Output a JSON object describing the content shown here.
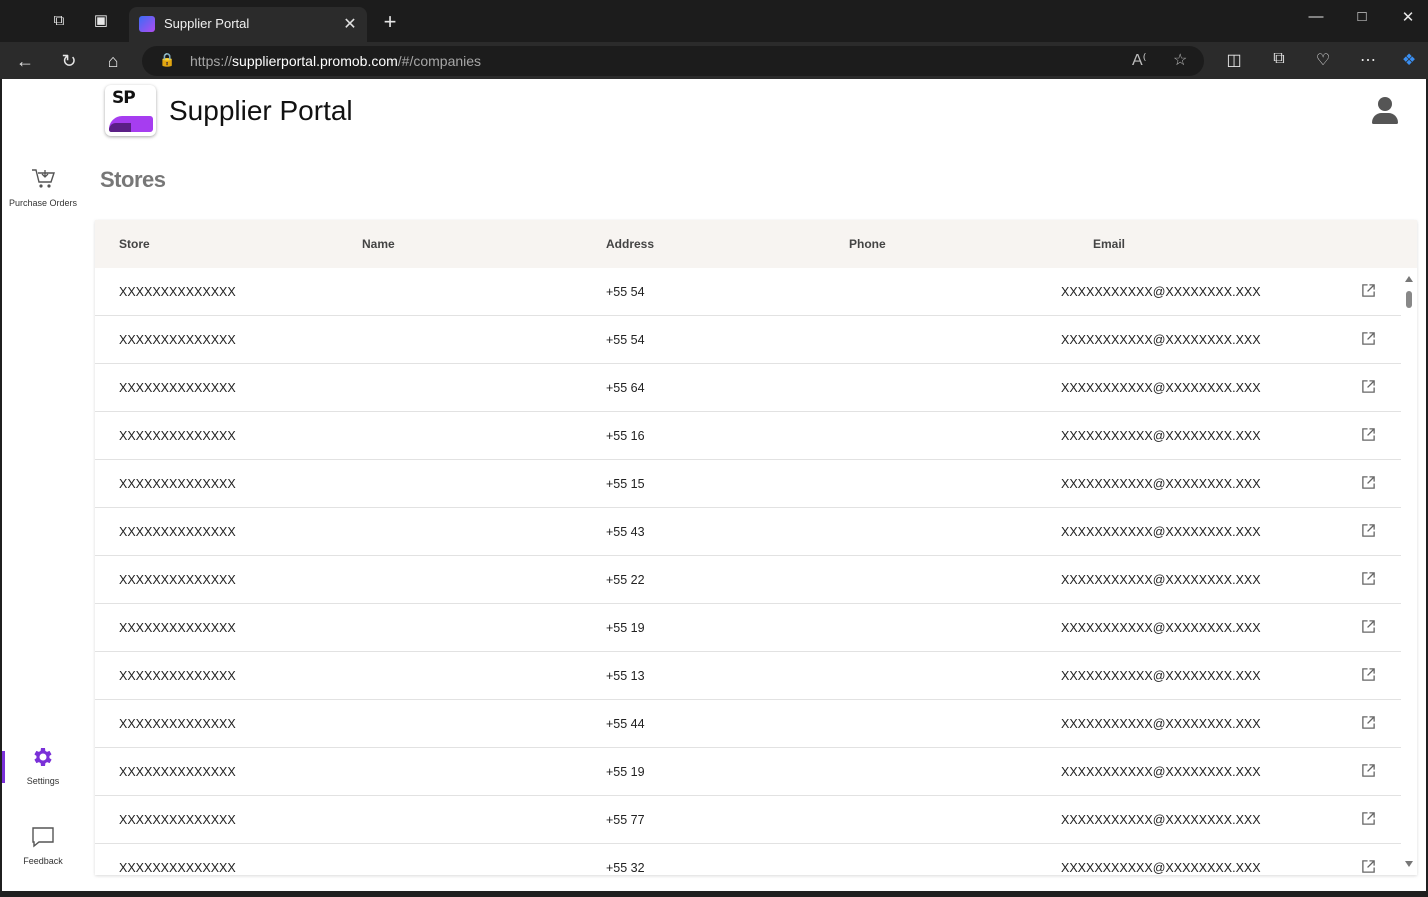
{
  "browser": {
    "tab_title": "Supplier Portal",
    "url_prefix": "https://",
    "url_host": "supplierportal.promob.com",
    "url_path": "/#/companies"
  },
  "header": {
    "logo_text": "SP",
    "app_title": "Supplier Portal"
  },
  "sidebar": {
    "items": [
      {
        "label": "Purchase Orders",
        "icon": "cart-icon"
      },
      {
        "label": "Settings",
        "icon": "gear-icon",
        "active": true
      },
      {
        "label": "Feedback",
        "icon": "chat-icon"
      }
    ],
    "accent_color": "#7a30d8"
  },
  "main": {
    "title": "Stores",
    "table": {
      "columns": [
        "Store",
        "Name",
        "Address",
        "Phone",
        "Email"
      ],
      "rows": [
        {
          "store": "XXXXXXXXXXXXXX",
          "phone": "+55 54",
          "email": "XXXXXXXXXXX@XXXXXXXX.XXX"
        },
        {
          "store": "XXXXXXXXXXXXXX",
          "phone": "+55 54",
          "email": "XXXXXXXXXXX@XXXXXXXX.XXX"
        },
        {
          "store": "XXXXXXXXXXXXXX",
          "phone": "+55 64",
          "email": "XXXXXXXXXXX@XXXXXXXX.XXX"
        },
        {
          "store": "XXXXXXXXXXXXXX",
          "phone": "+55 16",
          "email": "XXXXXXXXXXX@XXXXXXXX.XXX"
        },
        {
          "store": "XXXXXXXXXXXXXX",
          "phone": "+55 15",
          "email": "XXXXXXXXXXX@XXXXXXXX.XXX"
        },
        {
          "store": "XXXXXXXXXXXXXX",
          "phone": "+55 43",
          "email": "XXXXXXXXXXX@XXXXXXXX.XXX"
        },
        {
          "store": "XXXXXXXXXXXXXX",
          "phone": "+55 22",
          "email": "XXXXXXXXXXX@XXXXXXXX.XXX"
        },
        {
          "store": "XXXXXXXXXXXXXX",
          "phone": "+55 19",
          "email": "XXXXXXXXXXX@XXXXXXXX.XXX"
        },
        {
          "store": "XXXXXXXXXXXXXX",
          "phone": "+55 13",
          "email": "XXXXXXXXXXX@XXXXXXXX.XXX"
        },
        {
          "store": "XXXXXXXXXXXXXX",
          "phone": "+55 44",
          "email": "XXXXXXXXXXX@XXXXXXXX.XXX"
        },
        {
          "store": "XXXXXXXXXXXXXX",
          "phone": "+55 19",
          "email": "XXXXXXXXXXX@XXXXXXXX.XXX"
        },
        {
          "store": "XXXXXXXXXXXXXX",
          "phone": "+55 77",
          "email": "XXXXXXXXXXX@XXXXXXXX.XXX"
        },
        {
          "store": "XXXXXXXXXXXXXX",
          "phone": "+55 32",
          "email": "XXXXXXXXXXX@XXXXXXXX.XXX"
        }
      ]
    }
  }
}
